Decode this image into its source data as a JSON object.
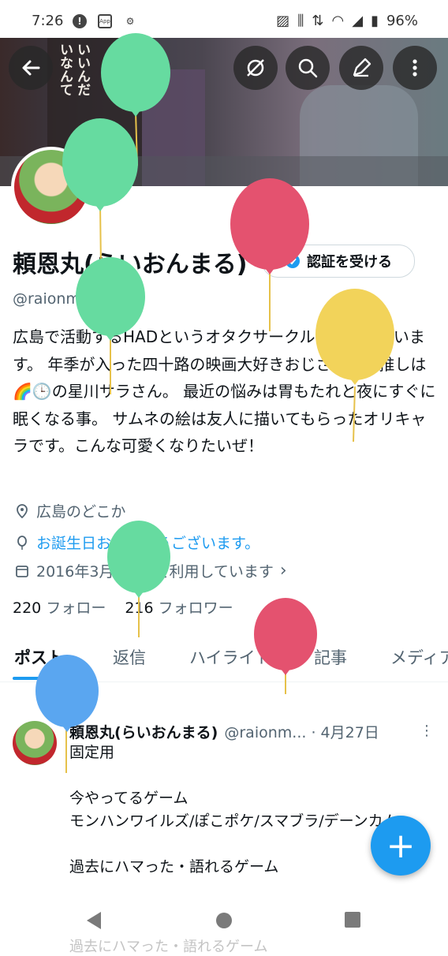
{
  "status_bar": {
    "time": "7:26",
    "battery": "96%",
    "icons": [
      "alert-icon",
      "app-icon",
      "gear-icon",
      "nfc-icon",
      "vibrate-icon",
      "data-arrows-icon",
      "wifi-icon",
      "signal-icon",
      "battery-icon"
    ]
  },
  "header": {
    "banner_texts": [
      "いなんて",
      "いいんだ"
    ],
    "buttons": [
      "back-arrow-icon",
      "mute-icon",
      "search-icon",
      "edit-icon",
      "more-vertical-icon"
    ]
  },
  "profile": {
    "name": "頼恩丸(らいおんまる)",
    "verify_button": "認証を受ける",
    "handle": "@raionmaru7",
    "bio": "広島で活動するHADというオタクサークルに所属しています。 年季が入った四十路の映画大好きおじさん。最推しは🌈🕒の星川サラさん。 最近の悩みは胃もたれと夜にすぐに眠くなる事。 サムネの絵は友人に描いてもらったオリキャラです。こんな可愛くなりたいぜ！",
    "location": "広島のどこか",
    "birthday": "お誕生日おめでとうございます。",
    "joined": "2016年3月からXを利用しています",
    "following_count": "220",
    "following_label": "フォロー",
    "followers_count": "216",
    "followers_label": "フォロワー"
  },
  "tabs": [
    "ポスト",
    "返信",
    "ハイライト",
    "記事",
    "メディア"
  ],
  "post": {
    "pinned_label": "固定",
    "author": "頼恩丸(らいおんまる)",
    "handle_date": "@raionm... · 4月27日",
    "body": "固定用\n\n今やってるゲーム\nモンハンワイルズ/ぽこポケ/スマブラ/デーンカム\n\n過去にハマった・語れるゲーム"
  },
  "fab_label": "+",
  "nav_ghost_text": "過去にハマった・語れるゲーム",
  "colors": {
    "accent": "#1d9bf0",
    "balloon_green": "#66dba0",
    "balloon_red": "#e4526f",
    "balloon_yellow": "#f2d35a",
    "balloon_blue": "#5aa6f0"
  }
}
